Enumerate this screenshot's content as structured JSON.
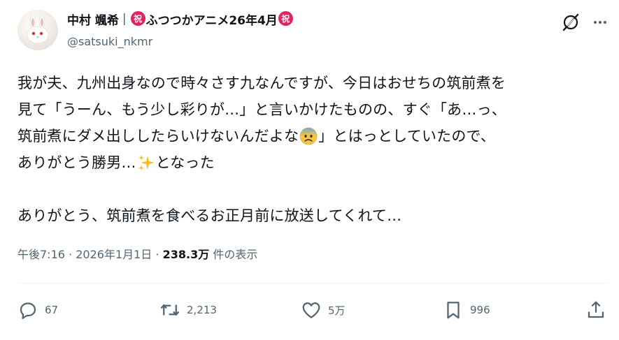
{
  "author": {
    "name_part1": "中村 颯希",
    "separator": "|",
    "badge_text": "祝",
    "name_part2": "ふつつかアニメ26年4月",
    "handle": "@satsuki_nkmr"
  },
  "tweet": {
    "line1": "我が夫、九州出身なので時々さす九なんですが、今日はおせちの筑前煮を",
    "line2": "見て「うーん、もう少し彩りが…」と言いかけたものの、すぐ「あ…っ、",
    "line3_a": "筑前煮にダメ出ししたらいけないんだよな",
    "line3_b": "」とはっとしていたので、",
    "line4_a": "ありがとう勝男…",
    "line4_b": "となった",
    "line5": "ありがとう、筑前煮を食べるお正月前に放送してくれて…"
  },
  "meta": {
    "time": "午後7:16",
    "dot1": "·",
    "date": "2026年1月1日",
    "dot2": "·",
    "views_count": "238.3万",
    "views_label": "件の表示"
  },
  "actions": {
    "replies": "67",
    "retweets": "2,213",
    "likes": "5万",
    "bookmarks": "996"
  },
  "icons": [
    "bunny-avatar",
    "grok-icon",
    "more-icon",
    "anxious-face-emoji",
    "sparkles-emoji",
    "reply-icon",
    "retweet-icon",
    "like-icon",
    "bookmark-icon",
    "share-icon"
  ],
  "colors": {
    "badge": "#e0245e",
    "text": "#0f1419",
    "muted": "#536471",
    "divider": "#eff3f4"
  }
}
